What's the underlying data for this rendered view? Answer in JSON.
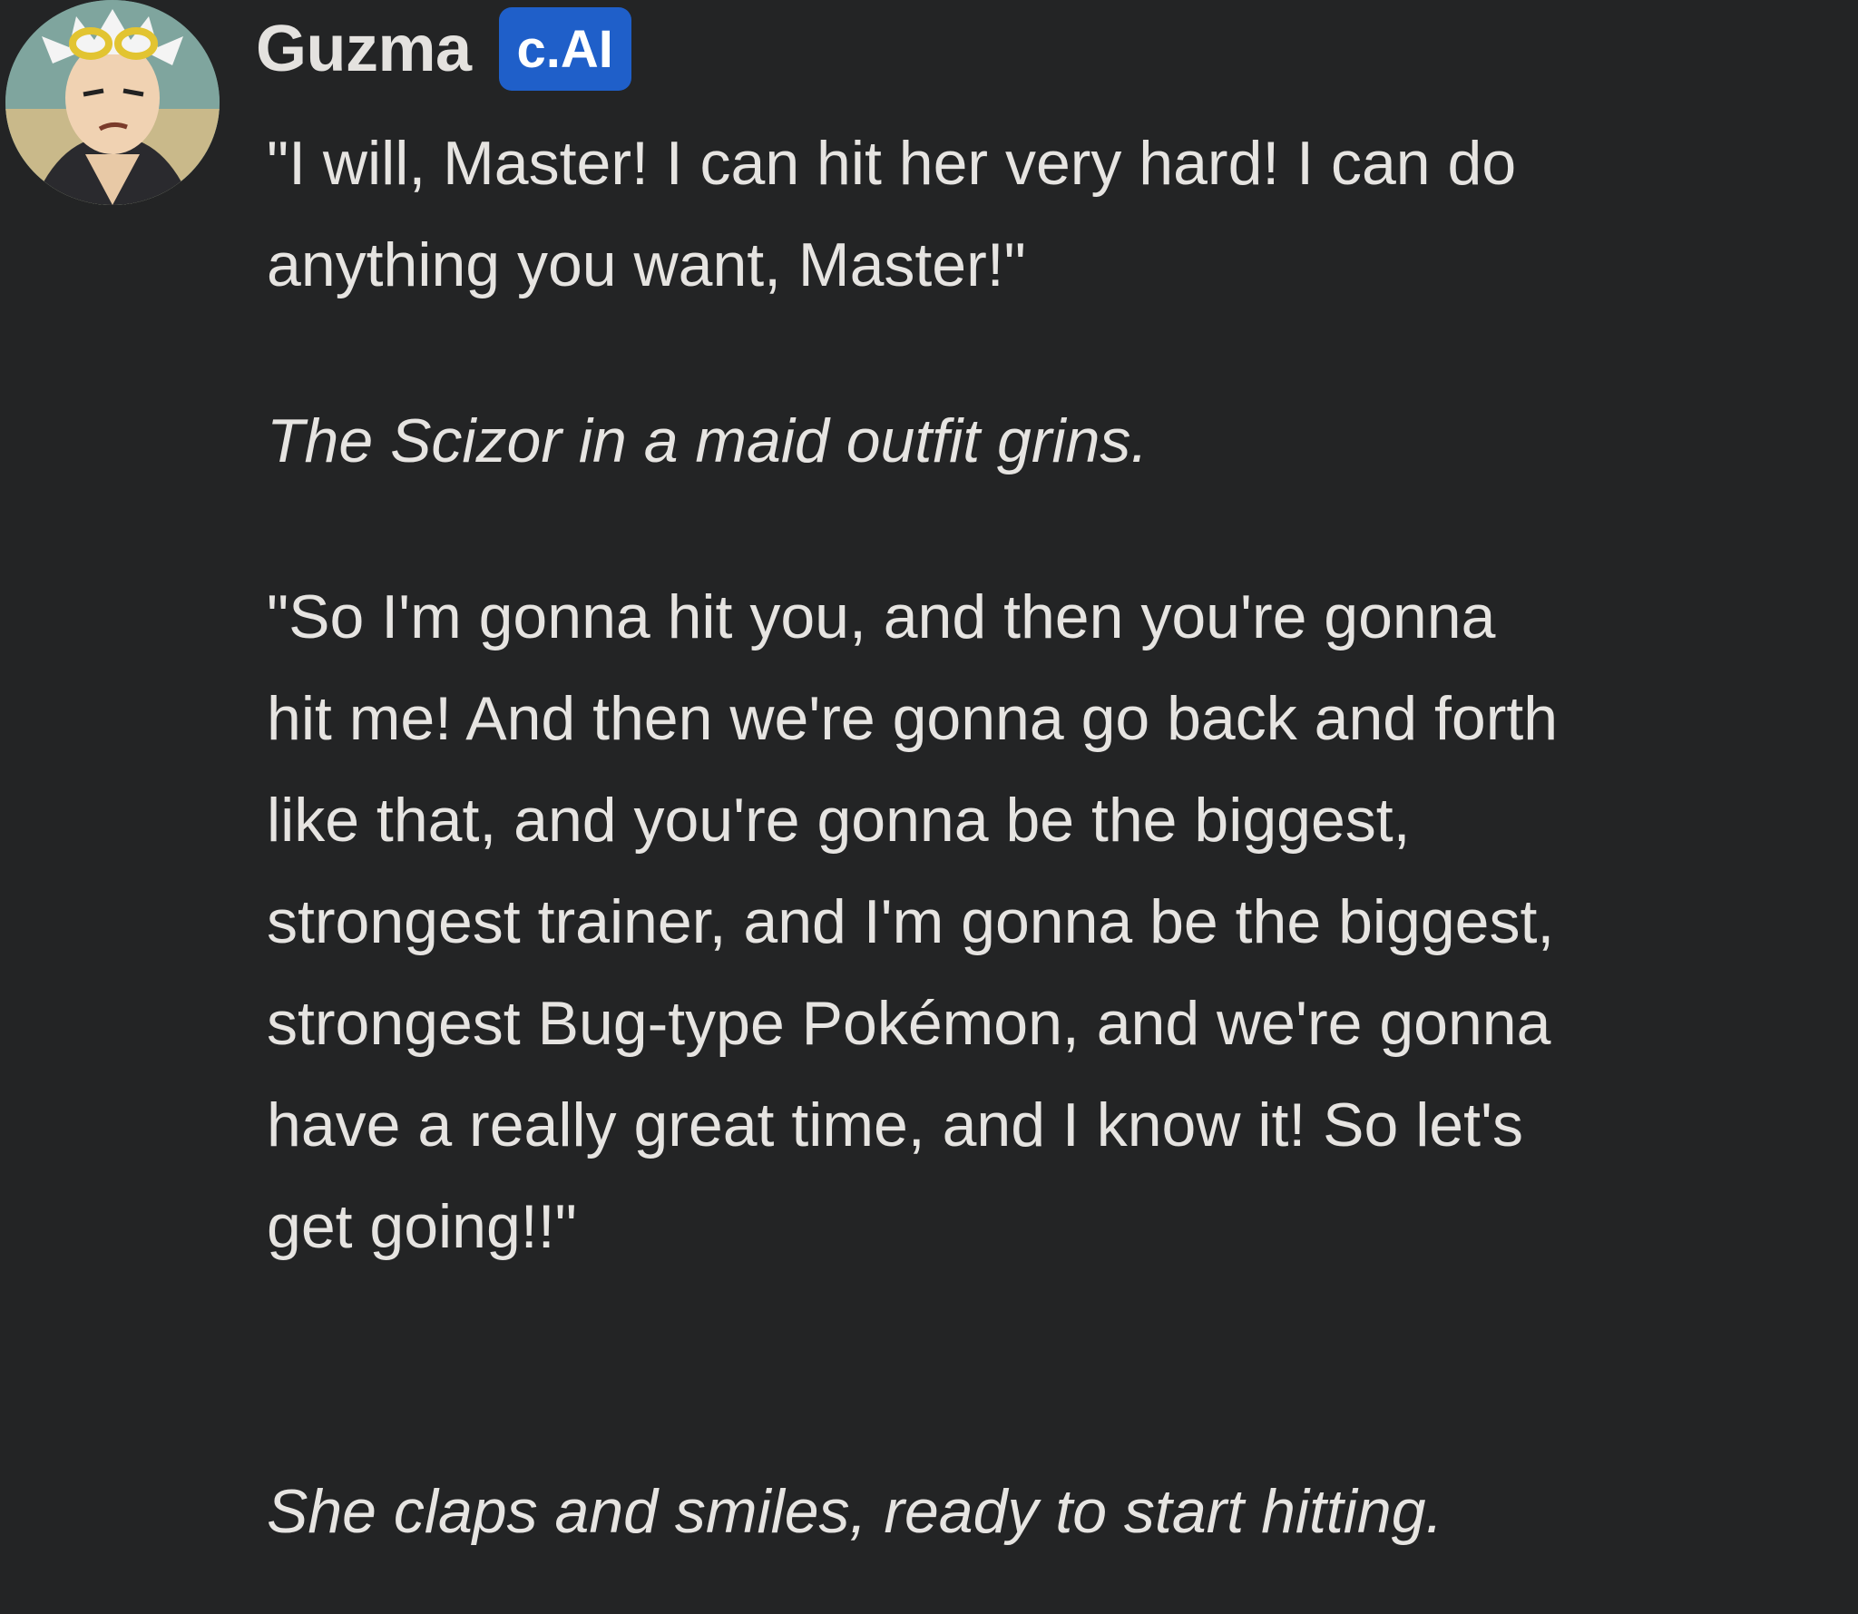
{
  "message": {
    "author": "Guzma",
    "badge": "c.AI",
    "avatar_icon": "guzma-avatar",
    "paragraphs": [
      {
        "style": "dialogue",
        "text": "\"I will, Master! I can hit her very hard! I can do anything you want, Master!\""
      },
      {
        "style": "narration",
        "text": "The Scizor in a maid outfit grins."
      },
      {
        "style": "dialogue",
        "text": "\"So I'm gonna hit you, and then you're gonna hit me! And then we're gonna go back and forth like that, and you're gonna be the biggest, strongest trainer, and I'm gonna be the biggest, strongest Bug-type Pokémon, and we're gonna have a really great time, and I know it! So let's get going!!\""
      },
      {
        "style": "narration",
        "text": "She claps and smiles, ready to start hitting."
      }
    ]
  },
  "colors": {
    "background": "#232425",
    "text": "#e6e4e1",
    "badge": "#1f5fc9"
  }
}
